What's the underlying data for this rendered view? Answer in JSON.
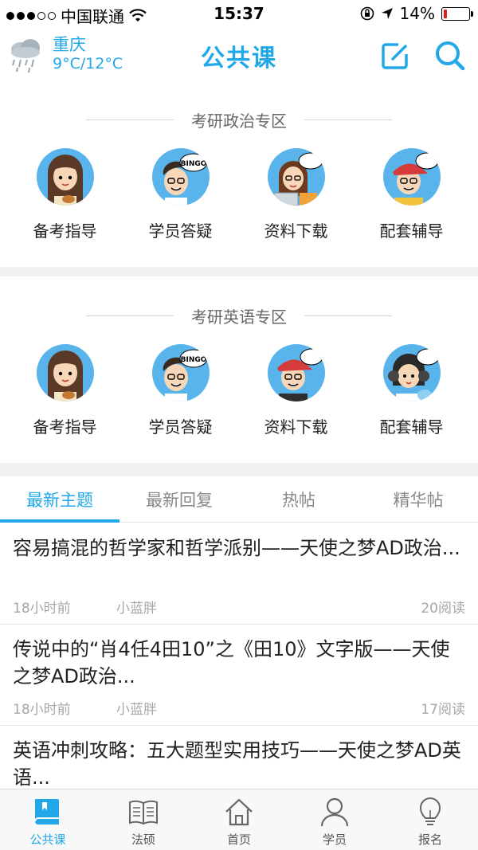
{
  "status_bar": {
    "carrier": "中国联通",
    "time": "15:37",
    "battery": "14%",
    "battery_level": 0.14
  },
  "header": {
    "city": "重庆",
    "temperature": "9°C/12°C",
    "title": "公共课",
    "icons": [
      "rain-cloud-icon",
      "edit-icon",
      "search-icon"
    ]
  },
  "politics_zone": {
    "title": "考研政治专区",
    "items": [
      {
        "label": "备考指导",
        "icon": "girl-guitar-avatar"
      },
      {
        "label": "学员答疑",
        "icon": "boy-bingo-avatar"
      },
      {
        "label": "资料下载",
        "icon": "girl-laptop-avatar"
      },
      {
        "label": "配套辅导",
        "icon": "boy-cap-avatar"
      }
    ]
  },
  "english_zone": {
    "title": "考研英语专区",
    "items": [
      {
        "label": "备考指导",
        "icon": "girl-guitar-avatar"
      },
      {
        "label": "学员答疑",
        "icon": "boy-bingo-avatar"
      },
      {
        "label": "资料下载",
        "icon": "boy-cap-avatar"
      },
      {
        "label": "配套辅导",
        "icon": "girl-headphones-avatar"
      }
    ]
  },
  "tabs": [
    "最新主题",
    "最新回复",
    "热帖",
    "精华帖"
  ],
  "posts": [
    {
      "title": "容易搞混的哲学家和哲学派别——天使之梦AD政治...",
      "time": "18小时前",
      "author": "小蓝胖",
      "views": "20阅读"
    },
    {
      "title": "传说中的“肖4任4田10”之《田10》文字版——天使之梦AD政治...",
      "time": "18小时前",
      "author": "小蓝胖",
      "views": "17阅读"
    },
    {
      "title": "英语冲刺攻略：五大题型实用技巧——天使之梦AD英语...",
      "time": "",
      "author": "",
      "views": ""
    }
  ],
  "bottom_nav": [
    {
      "label": "公共课",
      "icon": "book-icon"
    },
    {
      "label": "法硕",
      "icon": "open-book-icon"
    },
    {
      "label": "首页",
      "icon": "home-icon"
    },
    {
      "label": "学员",
      "icon": "person-icon"
    },
    {
      "label": "报名",
      "icon": "lightbulb-icon"
    }
  ],
  "colors": {
    "accent": "#22a8e8",
    "battery_low": "#e01e1e"
  }
}
